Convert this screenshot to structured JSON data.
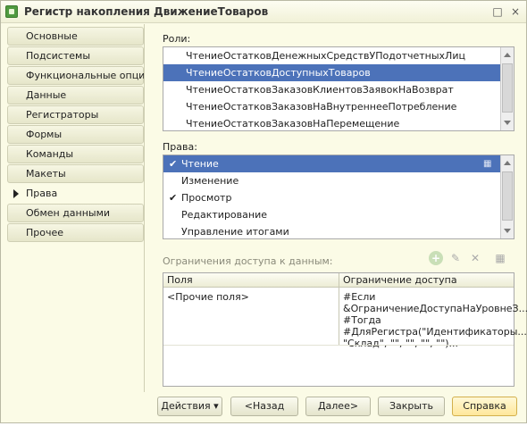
{
  "window": {
    "title": "Регистр накопления ДвижениеТоваров"
  },
  "nav": {
    "items": [
      {
        "label": "Основные"
      },
      {
        "label": "Подсистемы"
      },
      {
        "label": "Функциональные опции"
      },
      {
        "label": "Данные"
      },
      {
        "label": "Регистраторы"
      },
      {
        "label": "Формы"
      },
      {
        "label": "Команды"
      },
      {
        "label": "Макеты"
      },
      {
        "label": "Права",
        "active": true
      },
      {
        "label": "Обмен данными"
      },
      {
        "label": "Прочее"
      }
    ]
  },
  "roles": {
    "label": "Роли:",
    "items": [
      "ЧтениеОстатковДенежныхСредствУПодотчетныхЛиц",
      "ЧтениеОстатковДоступныхТоваров",
      "ЧтениеОстатковЗаказовКлиентовЗаявокНаВозврат",
      "ЧтениеОстатковЗаказовНаВнутреннееПотребление",
      "ЧтениеОстатковЗаказовНаПеремещение"
    ],
    "selected_index": 1
  },
  "rights": {
    "label": "Права:",
    "items": [
      {
        "label": "Чтение",
        "checked": true
      },
      {
        "label": "Изменение",
        "checked": false
      },
      {
        "label": "Просмотр",
        "checked": true
      },
      {
        "label": "Редактирование",
        "checked": false
      },
      {
        "label": "Управление итогами",
        "checked": false
      }
    ],
    "selected_index": 0
  },
  "restrictions": {
    "label": "Ограничения доступа к данным:",
    "columns": [
      "Поля",
      "Ограничение доступа"
    ],
    "rows": [
      {
        "field": "<Прочие поля>",
        "restriction": [
          "#Если",
          "&ОграничениеДоступаНаУровнеЗ...",
          " #Тогда",
          "#ДляРегистра(\"Идентификаторы...",
          " \"Склад\", \"\", \"\", \"\", \"\")..."
        ]
      }
    ]
  },
  "buttons": {
    "actions": "Действия",
    "back": "<Назад",
    "next": "Далее>",
    "close": "Закрыть",
    "help": "Справка"
  },
  "icons": {
    "close": "×",
    "maximize": "□",
    "add": "+",
    "edit": "✎",
    "delete": "✕",
    "wizard": "▦",
    "dropdown": "▾",
    "check": "✔"
  }
}
